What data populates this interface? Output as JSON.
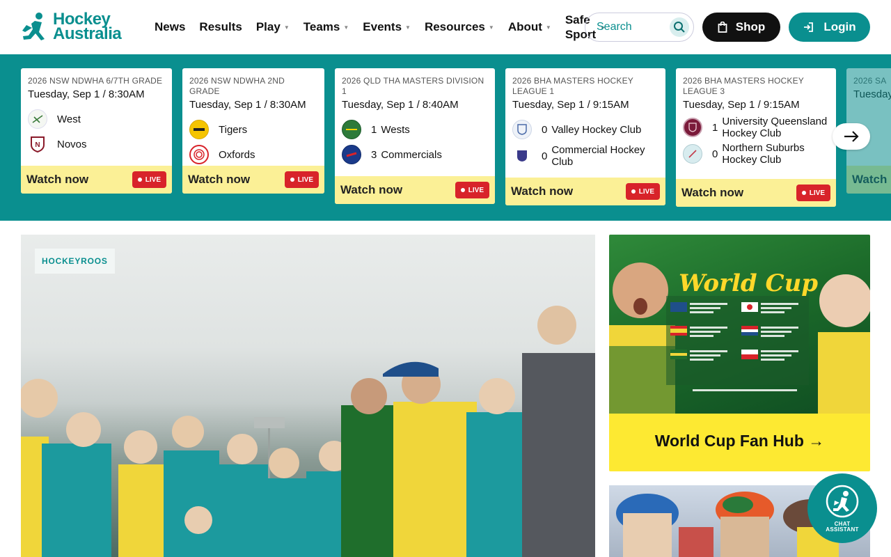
{
  "brand": {
    "line1": "Hockey",
    "line2": "Australia",
    "accent": "#0a8f8f"
  },
  "nav": {
    "items": [
      {
        "label": "News"
      },
      {
        "label": "Results"
      },
      {
        "label": "Play"
      },
      {
        "label": "Teams"
      },
      {
        "label": "Events"
      },
      {
        "label": "Resources"
      },
      {
        "label": "About"
      }
    ],
    "safe_sport_line1": "Safe",
    "safe_sport_line2": "Sport"
  },
  "search": {
    "placeholder": "Search"
  },
  "shop": {
    "label": "Shop"
  },
  "login": {
    "label": "Login"
  },
  "scores": {
    "watch_label": "Watch now",
    "live_label": "LIVE",
    "cards": [
      {
        "comp": "2026 NSW NDWHA 6/7TH GRADE",
        "date": "Tuesday, Sep 1 / 8:30AM",
        "home": {
          "name": "West",
          "score": ""
        },
        "away": {
          "name": "Novos",
          "score": ""
        }
      },
      {
        "comp": "2026 NSW NDWHA 2ND GRADE",
        "date": "Tuesday, Sep 1 / 8:30AM",
        "home": {
          "name": "Tigers",
          "score": ""
        },
        "away": {
          "name": "Oxfords",
          "score": ""
        }
      },
      {
        "comp": "2026 QLD THA MASTERS DIVISION 1",
        "date": "Tuesday, Sep 1 / 8:40AM",
        "home": {
          "name": "Wests",
          "score": "1"
        },
        "away": {
          "name": "Commercials",
          "score": "3"
        }
      },
      {
        "comp": "2026 BHA MASTERS HOCKEY LEAGUE 1",
        "date": "Tuesday, Sep 1 / 9:15AM",
        "home": {
          "name": "Valley Hockey Club",
          "score": "0"
        },
        "away": {
          "name": "Commercial Hockey Club",
          "score": "0"
        }
      },
      {
        "comp": "2026 BHA MASTERS HOCKEY LEAGUE 3",
        "date": "Tuesday, Sep 1 / 9:15AM",
        "home": {
          "name": "University Queensland Hockey Club",
          "score": "1"
        },
        "away": {
          "name": "Northern Suburbs Hockey Club",
          "score": "0"
        }
      },
      {
        "comp": "2026 SA",
        "date": "Tuesday"
      }
    ]
  },
  "hero": {
    "tag": "HOCKEYROOS"
  },
  "promo": {
    "heading": "World Cup",
    "title": "World Cup Fan Hub →"
  },
  "chat": {
    "line1": "CHAT",
    "line2": "ASSISTANT"
  }
}
